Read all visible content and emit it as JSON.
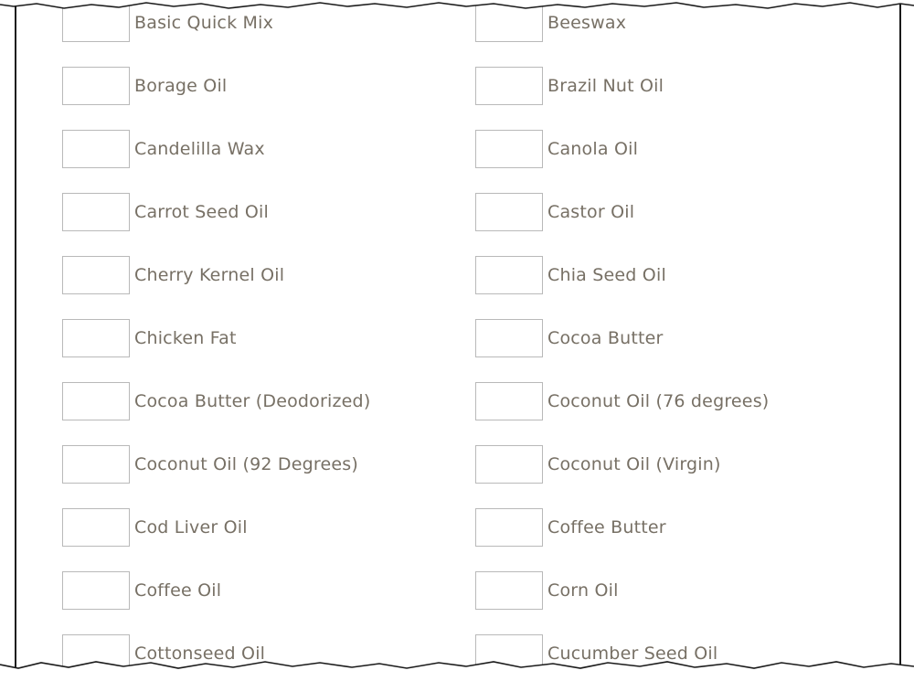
{
  "ingredients": {
    "rows": [
      {
        "left": "Basic Quick Mix",
        "right": "Beeswax"
      },
      {
        "left": "Borage Oil",
        "right": "Brazil Nut Oil"
      },
      {
        "left": "Candelilla Wax",
        "right": "Canola Oil"
      },
      {
        "left": "Carrot Seed Oil",
        "right": "Castor Oil"
      },
      {
        "left": "Cherry Kernel Oil",
        "right": "Chia Seed Oil"
      },
      {
        "left": "Chicken Fat",
        "right": "Cocoa Butter"
      },
      {
        "left": "Cocoa Butter (Deodorized)",
        "right": "Coconut Oil (76 degrees)"
      },
      {
        "left": "Coconut Oil (92 Degrees)",
        "right": "Coconut Oil (Virgin)"
      },
      {
        "left": "Cod Liver Oil",
        "right": "Coffee Butter"
      },
      {
        "left": "Coffee Oil",
        "right": "Corn Oil"
      },
      {
        "left": "Cottonseed Oil",
        "right": "Cucumber Seed Oil"
      }
    ]
  },
  "colors": {
    "label_text": "#777065",
    "input_border": "#b9b9b9",
    "frame_border": "#1a1a1a",
    "background": "#ffffff"
  }
}
